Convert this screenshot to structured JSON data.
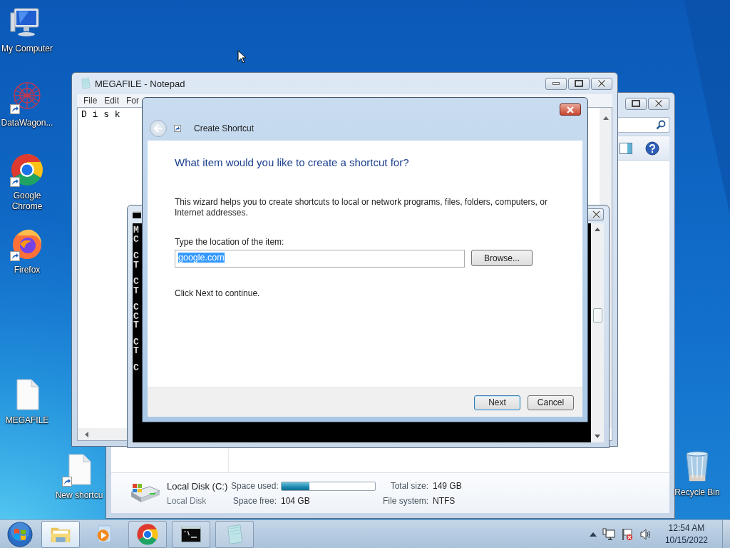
{
  "desktop_icons": [
    {
      "label": "My Computer",
      "kind": "computer",
      "shortcut": false
    },
    {
      "label": "DataWagon...",
      "kind": "mesh",
      "shortcut": true
    },
    {
      "label": "Google Chrome",
      "kind": "chrome",
      "shortcut": true
    },
    {
      "label": "Firefox",
      "kind": "firefox",
      "shortcut": true
    },
    {
      "label": "MEGAFILE",
      "kind": "document",
      "shortcut": false
    },
    {
      "label": "New shortcu",
      "kind": "document",
      "shortcut": true
    },
    {
      "label": "Recycle Bin",
      "kind": "recycle",
      "shortcut": false
    }
  ],
  "explorer": {
    "details": {
      "drive_name": "Local Disk (C:)",
      "drive_type": "Local Disk",
      "space_used_label": "Space used:",
      "level": 0.3,
      "space_free_label": "Space free:",
      "space_free": "104 GB",
      "total_size_label": "Total size:",
      "total_size": "149 GB",
      "file_system_label": "File system:",
      "file_system": "NTFS"
    }
  },
  "notepad": {
    "title": "MEGAFILE - Notepad",
    "menu": [
      "File",
      "Edit",
      "For"
    ],
    "text": "D i s k"
  },
  "console": {
    "blocks": [
      [
        "M",
        "C"
      ],
      [
        "C",
        "T"
      ],
      [
        "C",
        "T"
      ],
      [
        "C",
        "C",
        "T"
      ],
      [
        "C",
        "T"
      ],
      [
        "C"
      ]
    ]
  },
  "dialog": {
    "title": "Create Shortcut",
    "heading": "What item would you like to create a shortcut for?",
    "description": "This wizard helps you to create shortcuts to local or network programs, files, folders, computers, or Internet addresses.",
    "field_label": "Type the location of the item:",
    "field": {
      "value": "google.com",
      "selected": true
    },
    "browse_button": "Browse...",
    "hint": "Click Next to continue.",
    "buttons": [
      {
        "label": "Next",
        "default": true
      },
      {
        "label": "Cancel",
        "default": false
      }
    ]
  },
  "taskbar": {
    "items": [
      {
        "kind": "explorer",
        "selected": true
      },
      {
        "kind": "media",
        "selected": false
      },
      {
        "kind": "chrome",
        "selected": false
      },
      {
        "kind": "console",
        "selected": false
      },
      {
        "kind": "notepad",
        "selected": false
      }
    ],
    "clock": {
      "time": "12:54 AM",
      "date": "10/15/2022"
    }
  }
}
